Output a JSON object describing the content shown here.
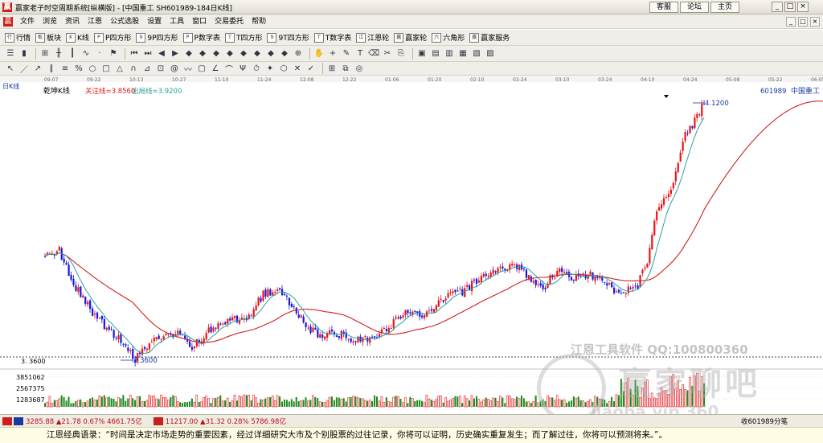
{
  "window": {
    "title": "赢家老子时空周期系统[纵横版] - [中国重工  SH601989-184日K线]",
    "buttons": [
      "客服",
      "论坛",
      "主页"
    ]
  },
  "menu": [
    "文件",
    "浏览",
    "资讯",
    "江恩",
    "公式选股",
    "设置",
    "工具",
    "窗口",
    "交易委托",
    "帮助"
  ],
  "toolbar1": [
    "行情",
    "板块",
    "K线",
    "P四方形",
    "9P四方形",
    "P数字表",
    "T四方形",
    "9T四方形",
    "T数字表",
    "江恩轮",
    "赢家轮",
    "六角形",
    "赢家服务"
  ],
  "chart": {
    "period_label": "日K线",
    "indicator_name": "乾坤K线",
    "watch_line": "关注线=3.8560",
    "exit_line": "出局线=3.9200",
    "stock_code": "601989",
    "stock_name": "中国重工",
    "date_ticks": [
      "09-07",
      "09-22",
      "10-13",
      "10-27",
      "11-10",
      "11-24",
      "12-08",
      "12-22",
      "01-06",
      "01-20",
      "02-10",
      "02-24",
      "03-10",
      "03-24",
      "04-10",
      "04-24",
      "05-08",
      "05-22",
      "06-05"
    ],
    "low_label": "3.3600",
    "high_label": "4.1200",
    "price_axis_label": "3. 3600",
    "volume_labels": [
      "3851062",
      "2567375",
      "1283687"
    ]
  },
  "status": {
    "sh": "3285.88 ▲21.78 0.67% 4661.75亿",
    "sz": "11217.00 ▲31.32 0.28% 5786.98亿",
    "right": "收601989分笔"
  },
  "quote": "江恩经典语录：“时间是决定市场走势的重要因素，经过详细研究大市及个别股票的过往记录，你将可以证明，历史确实重复发生；而了解过往，你将可以预测将来。”。",
  "watermark": {
    "line1": "江恩工具软件  QQ:100800360",
    "line2": "赢家聊吧",
    "line3": "liaoba.vip 360"
  },
  "colors": {
    "up": "#e8141a",
    "down": "#1616e0",
    "ma_short": "#2aa0a0",
    "ma_long": "#d02020",
    "vol_up": "#e8141a",
    "vol_down": "#1a8a1a"
  }
}
